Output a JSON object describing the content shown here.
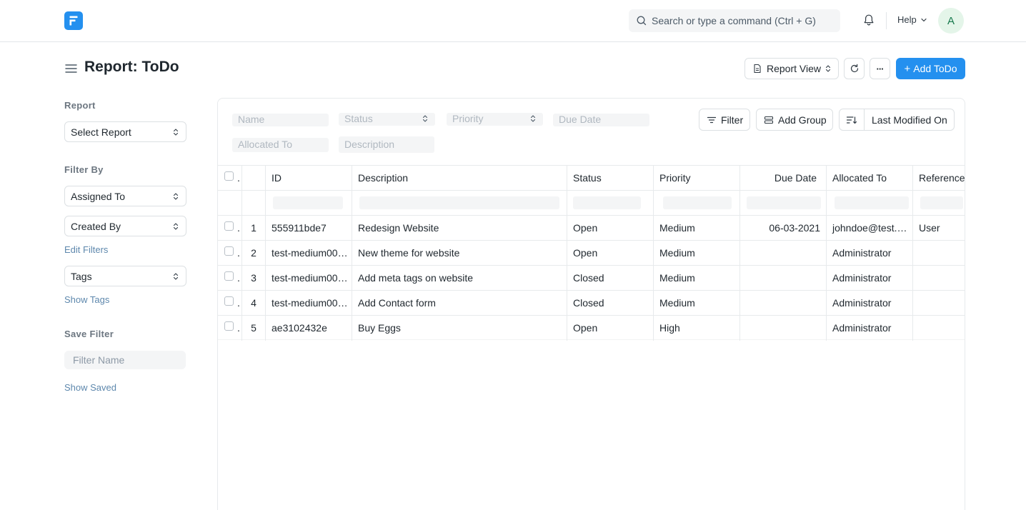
{
  "navbar": {
    "search_placeholder": "Search or type a command (Ctrl + G)",
    "help_label": "Help",
    "avatar_initial": "A"
  },
  "page": {
    "title": "Report: ToDo",
    "report_view_label": "Report View",
    "more_label": "···",
    "add_label": "Add ToDo",
    "add_icon": "+"
  },
  "sidebar": {
    "report_heading": "Report",
    "select_report": "Select Report",
    "filter_by_heading": "Filter By",
    "assigned_to": "Assigned To",
    "created_by": "Created By",
    "edit_filters": "Edit Filters",
    "tags": "Tags",
    "show_tags": "Show Tags",
    "save_filter_heading": "Save Filter",
    "filter_name_placeholder": "Filter Name",
    "show_saved": "Show Saved"
  },
  "filters": {
    "name": "Name",
    "status": "Status",
    "priority": "Priority",
    "due_date": "Due Date",
    "allocated_to": "Allocated To",
    "description": "Description",
    "filter_button": "Filter",
    "add_group_button": "Add Group",
    "sort_label": "Last Modified On"
  },
  "table": {
    "columns": [
      "ID",
      "Description",
      "Status",
      "Priority",
      "Due Date",
      "Allocated To",
      "Reference"
    ],
    "row_index_header": ".",
    "rows": [
      {
        "n": "1",
        "id": "555911bde7",
        "description": "Redesign Website",
        "status": "Open",
        "priority": "Medium",
        "due_date": "06-03-2021",
        "allocated_to": "johndoe@test.…",
        "reference": "User"
      },
      {
        "n": "2",
        "id": "test-medium00…",
        "description": "New theme for website",
        "status": "Open",
        "priority": "Medium",
        "due_date": "",
        "allocated_to": "Administrator",
        "reference": ""
      },
      {
        "n": "3",
        "id": "test-medium00…",
        "description": "Add meta tags on website",
        "status": "Closed",
        "priority": "Medium",
        "due_date": "",
        "allocated_to": "Administrator",
        "reference": ""
      },
      {
        "n": "4",
        "id": "test-medium00…",
        "description": "Add Contact form",
        "status": "Closed",
        "priority": "Medium",
        "due_date": "",
        "allocated_to": "Administrator",
        "reference": ""
      },
      {
        "n": "5",
        "id": "ae3102432e",
        "description": "Buy Eggs",
        "status": "Open",
        "priority": "High",
        "due_date": "",
        "allocated_to": "Administrator",
        "reference": ""
      }
    ]
  },
  "colors": {
    "primary": "#2490ef",
    "link": "#5e88ad",
    "muted": "#6c7680"
  }
}
